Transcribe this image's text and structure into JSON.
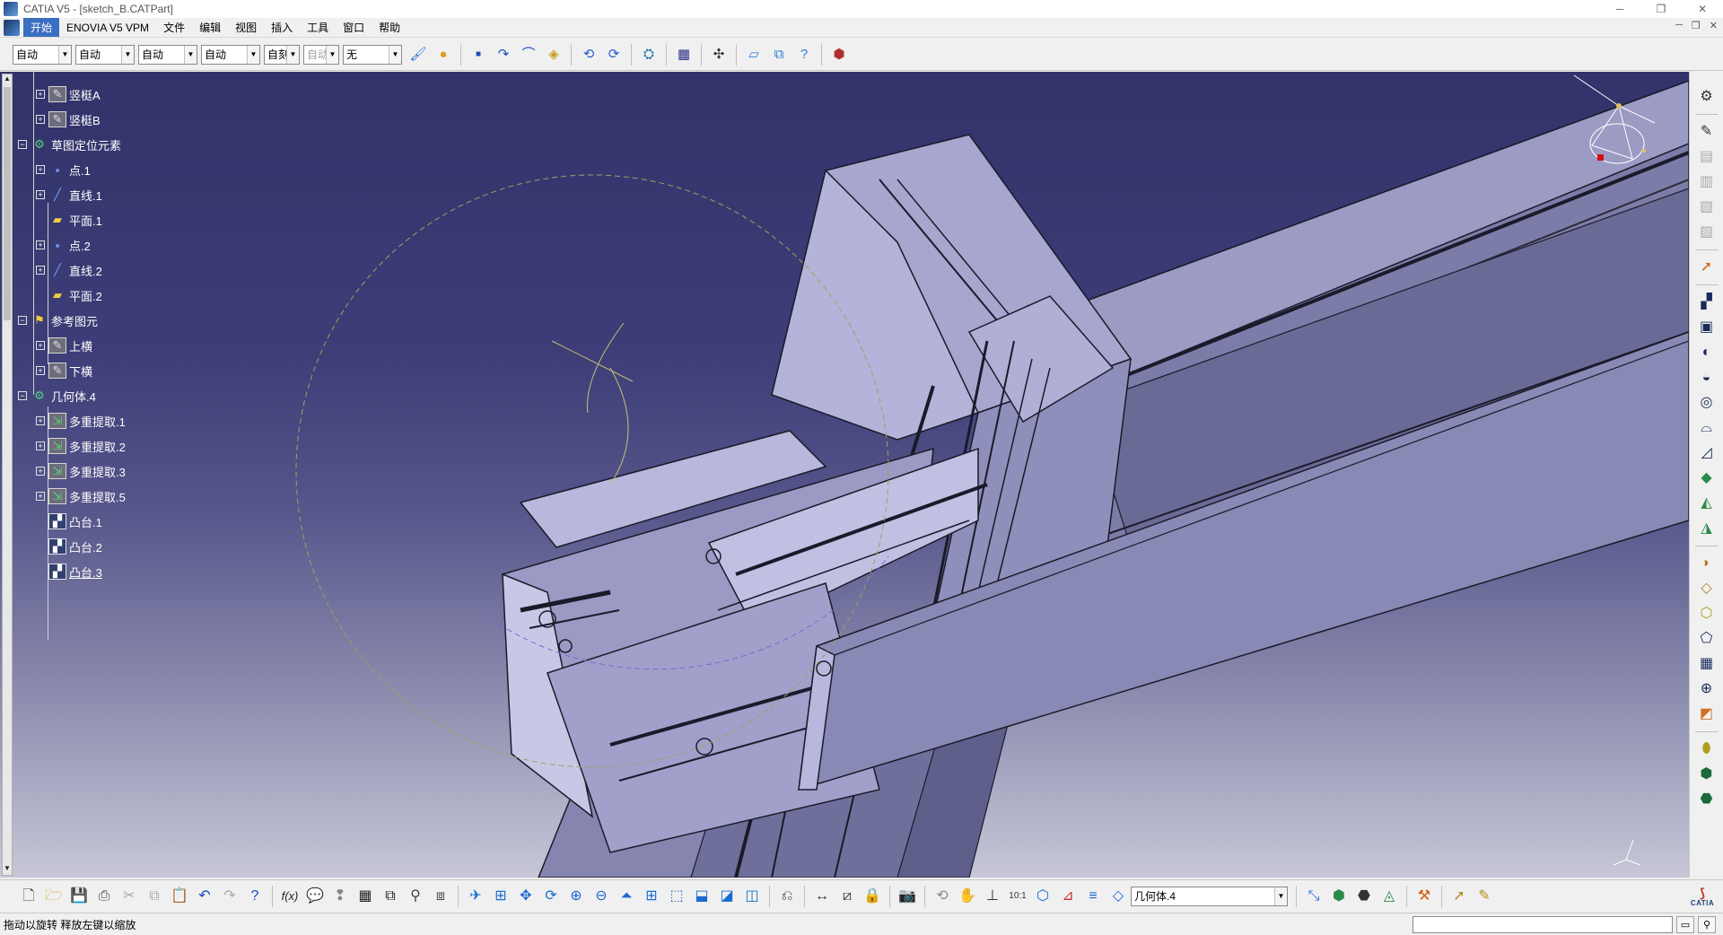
{
  "window": {
    "title": "CATIA V5 - [sketch_B.CATPart]",
    "controls": [
      "─",
      "❐",
      "✕"
    ],
    "mdi_controls": [
      "─",
      "❐",
      "✕"
    ]
  },
  "menu": {
    "items": [
      "开始",
      "ENOVIA V5 VPM",
      "文件",
      "编辑",
      "视图",
      "插入",
      "工具",
      "窗口",
      "帮助"
    ]
  },
  "toolbar_top": {
    "combos": [
      "自动",
      "自动",
      "自动",
      "自动",
      "自刻",
      "自动",
      "无"
    ]
  },
  "tree": {
    "nodes": [
      {
        "label": "竖梃A",
        "icon": "sketch-icon"
      },
      {
        "label": "竖梃B",
        "icon": "sketch-icon"
      },
      {
        "label": "草图定位元素",
        "icon": "geometrical-set-icon"
      },
      {
        "label": "点.1",
        "icon": "point-icon"
      },
      {
        "label": "直线.1",
        "icon": "line-icon"
      },
      {
        "label": "平面.1",
        "icon": "plane-icon"
      },
      {
        "label": "点.2",
        "icon": "point-icon"
      },
      {
        "label": "直线.2",
        "icon": "line-icon"
      },
      {
        "label": "平面.2",
        "icon": "plane-icon"
      },
      {
        "label": "参考图元",
        "icon": "reference-icon"
      },
      {
        "label": "上横",
        "icon": "sketch-icon"
      },
      {
        "label": "下横",
        "icon": "sketch-icon"
      },
      {
        "label": "几何体.4",
        "icon": "geometrical-set-icon"
      },
      {
        "label": "多重提取.1",
        "icon": "multi-extract-icon"
      },
      {
        "label": "多重提取.2",
        "icon": "multi-extract-icon"
      },
      {
        "label": "多重提取.3",
        "icon": "multi-extract-icon"
      },
      {
        "label": "多重提取.5",
        "icon": "multi-extract-icon"
      },
      {
        "label": "凸台.1",
        "icon": "pad-icon"
      },
      {
        "label": "凸台.2",
        "icon": "pad-icon"
      },
      {
        "label": "凸台.3",
        "icon": "pad-icon"
      }
    ]
  },
  "toolbar_bottom": {
    "current_body": "几何体.4"
  },
  "status": {
    "message": "拖动以旋转  释放左键以缩放",
    "command_input": ""
  },
  "logo": {
    "brand": "CATIA"
  },
  "colors": {
    "viewport_top": "#33336b",
    "viewport_bottom": "#c7c7d8",
    "part_face": "#a8a8d0",
    "part_edge": "#1a1a2a",
    "menu_active": "#3b6ec0"
  }
}
